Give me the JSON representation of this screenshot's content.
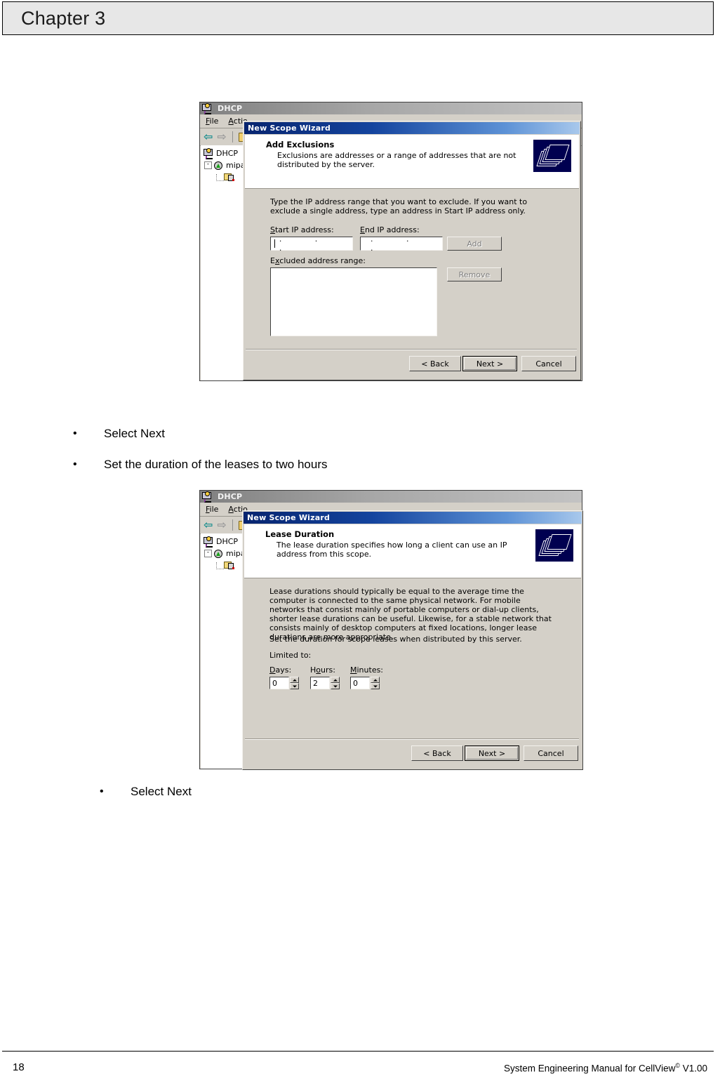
{
  "page": {
    "chapter_title": "Chapter 3",
    "page_number": "18",
    "footer_right_main": "System Engineering Manual for CellView",
    "footer_right_sup": "©",
    "footer_right_tail": " V1.00"
  },
  "bullets": {
    "b1": "Select Next",
    "b2": "Set the duration of the leases to two hours",
    "b3": "Select Next"
  },
  "mmc": {
    "window_title": "DHCP",
    "menu": {
      "file": "File",
      "file_mnemonic": "F",
      "action": "Actio",
      "action_mnemonic": "A"
    },
    "tree": {
      "root": "DHCP",
      "server": "mipa",
      "expander": "-"
    },
    "icons": {
      "title_icon": "dhcp-console-icon",
      "back": "⇐",
      "forward": "⇒"
    }
  },
  "dialog1": {
    "title": "New Scope Wizard",
    "head_title": "Add Exclusions",
    "head_sub": "Exclusions are addresses or a range of addresses that are not distributed by the server.",
    "intro": "Type the IP address range that you want to exclude. If you want to exclude a single address, type an address in Start IP address only.",
    "start_label_mnemonic": "S",
    "start_label": "tart IP address:",
    "end_label_mnemonic": "E",
    "end_label": "nd IP address:",
    "start_value": "",
    "end_value": "",
    "ip_separator": ".  .  .",
    "excluded_label_pre": "E",
    "excluded_label_mnemonic": "x",
    "excluded_label_post": "cluded address range:",
    "excluded_items": [],
    "add_button": "Add",
    "add_button_mnemonic": "dd",
    "remove_button": "Remove",
    "remove_button_mnemonic": "v",
    "back_button": "< Back",
    "back_mnemonic": "B",
    "next_button": "Next >",
    "next_mnemonic": "N",
    "cancel_button": "Cancel"
  },
  "dialog2": {
    "title": "New Scope Wizard",
    "head_title": "Lease Duration",
    "head_sub": "The lease duration specifies how long a client can use an IP address from this scope.",
    "para1": "Lease durations should typically be equal to the average time the computer is connected to the same physical network. For mobile networks that consist mainly of portable computers or dial-up clients, shorter lease durations can be useful. Likewise, for a stable network that consists mainly of desktop computers at fixed locations, longer lease durations are more appropriate.",
    "para2": "Set the duration for scope leases when distributed by this server.",
    "limited_label": "Limited to:",
    "days_label_mnemonic": "D",
    "days_label": "ays:",
    "hours_label_pre": "H",
    "hours_label_mnemonic": "o",
    "hours_label_post": "urs:",
    "minutes_label_mnemonic": "M",
    "minutes_label": "inutes:",
    "days_value": "0",
    "hours_value": "2",
    "minutes_value": "0",
    "back_button": "< Back",
    "back_mnemonic": "B",
    "next_button": "Next >",
    "next_mnemonic": "N",
    "cancel_button": "Cancel"
  },
  "colors": {
    "chrome_face": "#d4d0c8",
    "title_blue": "#07246f",
    "page_header_bg": "#e7e7e7"
  }
}
